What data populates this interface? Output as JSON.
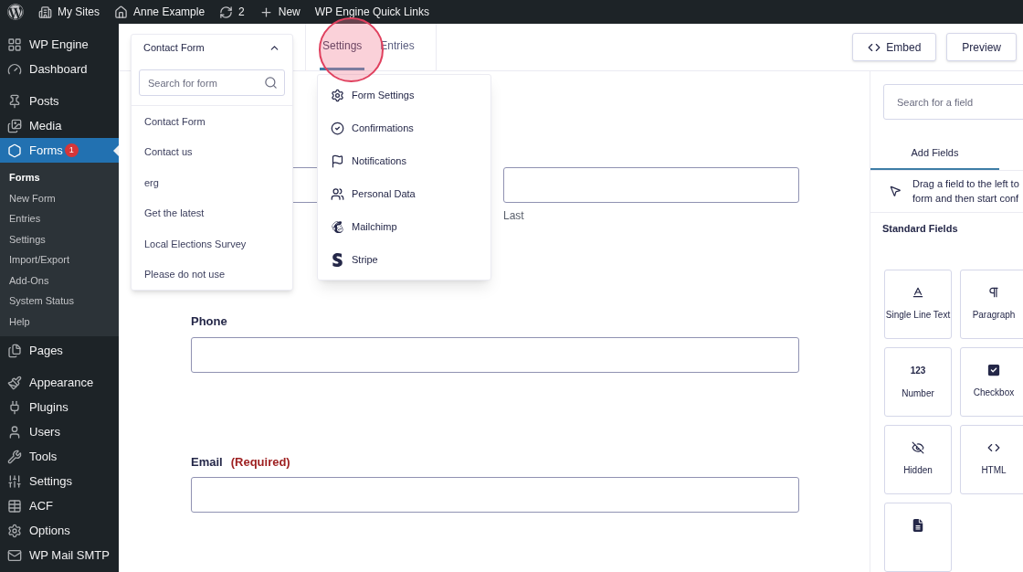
{
  "admin_bar": [
    {
      "kind": "logo"
    },
    {
      "kind": "link",
      "label": "My Sites"
    },
    {
      "kind": "link",
      "label": "Anne Example"
    },
    {
      "kind": "link",
      "label": "2"
    },
    {
      "kind": "link",
      "label": "New"
    },
    {
      "kind": "link",
      "label": "WP Engine Quick Links"
    }
  ],
  "sidebar": {
    "items": [
      {
        "label": "WP Engine",
        "selected": false
      },
      {
        "label": "Dashboard",
        "selected": false
      },
      {
        "label": "Posts",
        "selected": false
      },
      {
        "label": "Media",
        "selected": false
      },
      {
        "label": "Forms",
        "selected": true,
        "badge": "1",
        "children": [
          {
            "label": "Forms",
            "selected": true
          },
          {
            "label": "New Form",
            "selected": false
          },
          {
            "label": "Entries",
            "selected": false
          },
          {
            "label": "Settings",
            "selected": false
          },
          {
            "label": "Import/Export",
            "selected": false
          },
          {
            "label": "Add-Ons",
            "selected": false
          },
          {
            "label": "System Status",
            "selected": false
          },
          {
            "label": "Help",
            "selected": false
          }
        ]
      },
      {
        "label": "Pages",
        "selected": false
      },
      {
        "label": "Appearance",
        "selected": false
      },
      {
        "label": "Plugins",
        "selected": false
      },
      {
        "label": "Users",
        "selected": false
      },
      {
        "label": "Tools",
        "selected": false
      },
      {
        "label": "Settings",
        "selected": false
      },
      {
        "label": "ACF",
        "selected": false
      },
      {
        "label": "Options",
        "selected": false
      },
      {
        "label": "WP Mail SMTP",
        "selected": false
      }
    ]
  },
  "toolbar": {
    "form_selector": {
      "title": "Contact Form",
      "expanded": true,
      "search_placeholder": "Search for form",
      "forms": [
        "Contact Form",
        "Contact us",
        "erg",
        "Get the latest",
        "Local Elections Survey",
        "Please do not use"
      ]
    },
    "tabs": [
      {
        "label": "Settings",
        "selected": true
      },
      {
        "label": "Entries",
        "selected": false
      }
    ],
    "settings_menu": [
      "Form Settings",
      "Confirmations",
      "Notifications",
      "Personal Data",
      "Mailchimp",
      "Stripe"
    ],
    "buttons": [
      "Embed",
      "Preview"
    ]
  },
  "form": {
    "name_row": {
      "sublabel_last": "Last"
    },
    "fields": [
      {
        "label": "Phone"
      },
      {
        "label": "Email",
        "required_text": "(Required)"
      }
    ]
  },
  "right_panel": {
    "search_placeholder": "Search for a field",
    "tabs": [
      {
        "label": "Add Fields",
        "selected": true
      }
    ],
    "hint_lines": [
      "Drag a field to the left to",
      "form and then start conf"
    ],
    "section_title": "Standard Fields",
    "fields": [
      {
        "kind": "icon",
        "label": "Single Line Text"
      },
      {
        "kind": "icon",
        "label": "Paragraph"
      },
      {
        "kind": "glyph",
        "glyph": "123",
        "label": "Number"
      },
      {
        "kind": "icon",
        "label": "Checkbox"
      },
      {
        "kind": "icon",
        "label": "Hidden"
      },
      {
        "kind": "icon",
        "label": "HTML"
      },
      {
        "kind": "icon"
      }
    ]
  }
}
